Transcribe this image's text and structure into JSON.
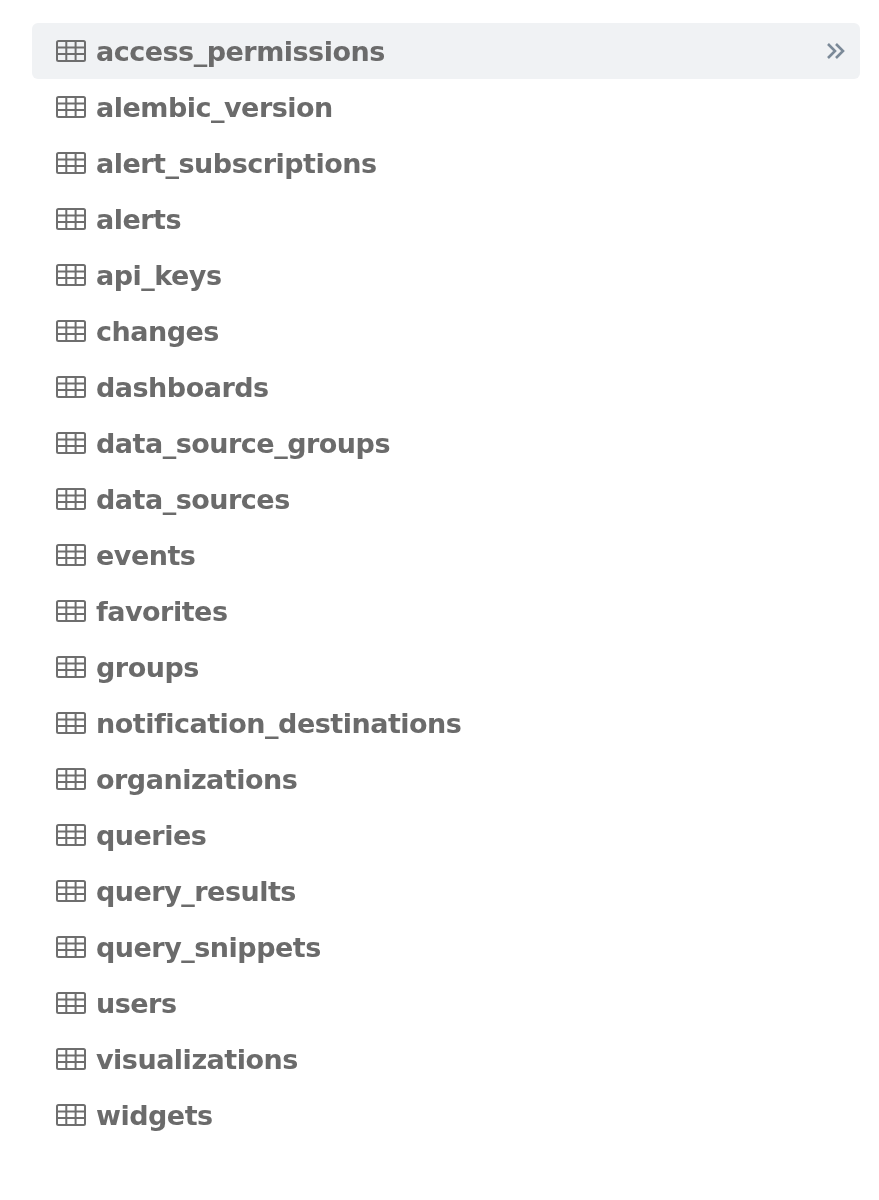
{
  "tables": [
    {
      "name": "access_permissions",
      "selected": true
    },
    {
      "name": "alembic_version",
      "selected": false
    },
    {
      "name": "alert_subscriptions",
      "selected": false
    },
    {
      "name": "alerts",
      "selected": false
    },
    {
      "name": "api_keys",
      "selected": false
    },
    {
      "name": "changes",
      "selected": false
    },
    {
      "name": "dashboards",
      "selected": false
    },
    {
      "name": "data_source_groups",
      "selected": false
    },
    {
      "name": "data_sources",
      "selected": false
    },
    {
      "name": "events",
      "selected": false
    },
    {
      "name": "favorites",
      "selected": false
    },
    {
      "name": "groups",
      "selected": false
    },
    {
      "name": "notification_destinations",
      "selected": false
    },
    {
      "name": "organizations",
      "selected": false
    },
    {
      "name": "queries",
      "selected": false
    },
    {
      "name": "query_results",
      "selected": false
    },
    {
      "name": "query_snippets",
      "selected": false
    },
    {
      "name": "users",
      "selected": false
    },
    {
      "name": "visualizations",
      "selected": false
    },
    {
      "name": "widgets",
      "selected": false
    }
  ]
}
